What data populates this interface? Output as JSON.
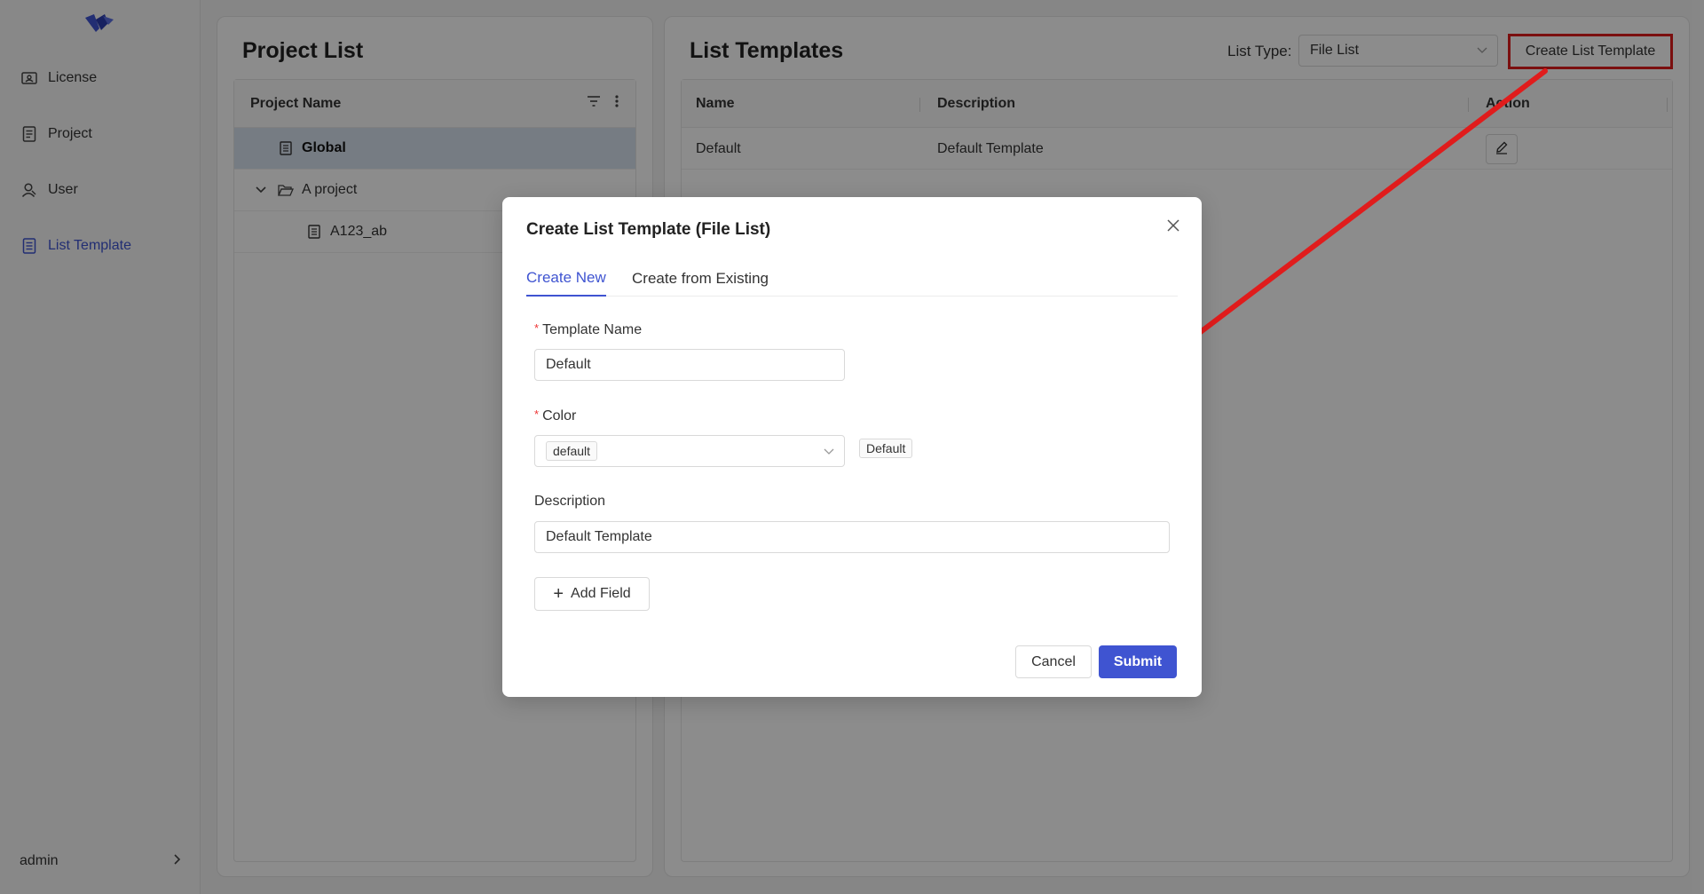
{
  "sidebar": {
    "logo": "brand-logo",
    "items": [
      {
        "label": "License",
        "icon": "license-icon"
      },
      {
        "label": "Project",
        "icon": "project-icon"
      },
      {
        "label": "User",
        "icon": "user-icon"
      },
      {
        "label": "List Template",
        "icon": "list-template-icon",
        "active": true
      }
    ],
    "user": {
      "name": "admin",
      "icon": "chevron-right-icon"
    }
  },
  "project_panel": {
    "title": "Project List",
    "column_header": "Project Name",
    "tree": [
      {
        "label": "Global",
        "icon": "document-icon",
        "selected": true,
        "level": 0
      },
      {
        "label": "A project",
        "icon": "folder-open-icon",
        "expanded": true,
        "level": 0
      },
      {
        "label": "A123_ab",
        "icon": "document-icon",
        "level": 1
      }
    ]
  },
  "templates_panel": {
    "title": "List Templates",
    "list_type_label": "List Type:",
    "list_type_value": "File List",
    "create_button": "Create List Template",
    "columns": [
      "Name",
      "Description",
      "Action"
    ],
    "rows": [
      {
        "name": "Default",
        "description": "Default Template"
      }
    ]
  },
  "modal": {
    "title": "Create List Template (File List)",
    "tabs": [
      "Create New",
      "Create from Existing"
    ],
    "active_tab": 0,
    "template_name_label": "Template Name",
    "template_name_value": "Default",
    "color_label": "Color",
    "color_value": "default",
    "color_preview": "Default",
    "description_label": "Description",
    "description_value": "Default Template",
    "add_field_label": "Add Field",
    "cancel_label": "Cancel",
    "submit_label": "Submit"
  },
  "colors": {
    "accent": "#3f54d1",
    "annotation": "#e01c1c",
    "selected_row": "#d8e2ee"
  }
}
